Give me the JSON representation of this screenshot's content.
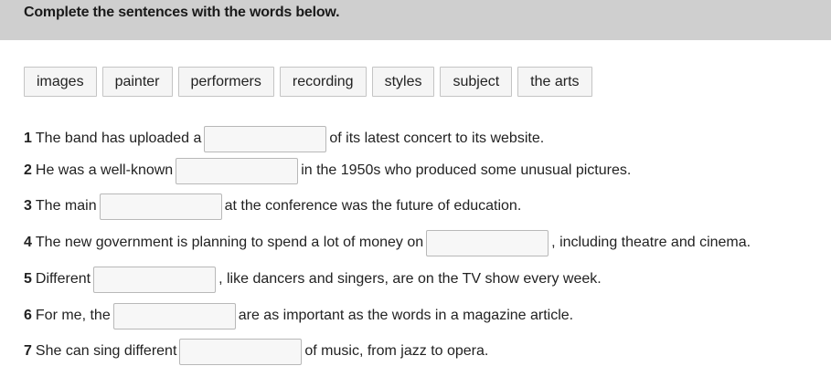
{
  "header": {
    "title": "Complete the sentences with the words below."
  },
  "word_bank": [
    "images",
    "painter",
    "performers",
    "recording",
    "styles",
    "subject",
    "the arts"
  ],
  "sentences": [
    {
      "num": "1",
      "before": "The band has uploaded a",
      "after": "of its latest concert to its website.",
      "value": ""
    },
    {
      "num": "2",
      "before": "He was a well-known",
      "after": "in the 1950s who produced some unusual pictures.",
      "value": ""
    },
    {
      "num": "3",
      "before": "The main",
      "after": "at the conference was the future of education.",
      "value": ""
    },
    {
      "num": "4",
      "before": "The new government is planning to spend a lot of money on",
      "after": ", including theatre and cinema.",
      "value": ""
    },
    {
      "num": "5",
      "before": "Different",
      "after": ", like dancers and singers, are on the TV show every week.",
      "value": ""
    },
    {
      "num": "6",
      "before": "For me, the",
      "after": "are as important as the words in a magazine article.",
      "value": ""
    },
    {
      "num": "7",
      "before": "She can sing different",
      "after": "of music, from jazz to opera.",
      "value": ""
    }
  ]
}
